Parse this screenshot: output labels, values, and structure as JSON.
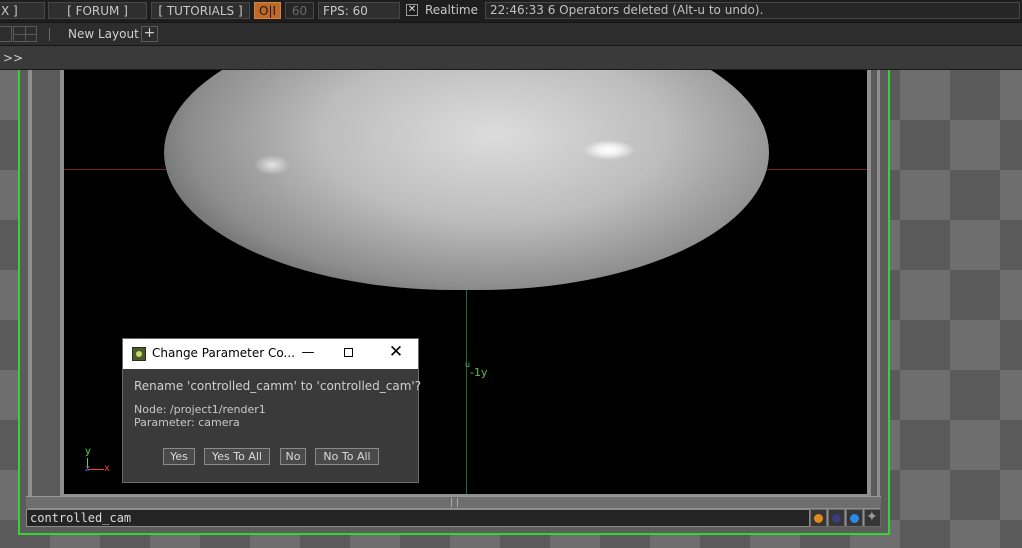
{
  "topbar": {
    "cut_label": "X ]",
    "forum_label": "[ FORUM ]",
    "tutorials_label": "[ TUTORIALS ]",
    "oi_label": "O|I",
    "fps_target": "60",
    "fps_label": "FPS:  60",
    "realtime_checked": "✕",
    "realtime_label": "Realtime",
    "status_message": "22:46:33 6 Operators deleted (Alt-u to undo)."
  },
  "layoutbar": {
    "new_layout_label": "New Layout",
    "add_label": "+"
  },
  "pathbar": {
    "chevron": ">>"
  },
  "viewer": {
    "y_axis_label": "-1y",
    "y_axis_tick": "u",
    "gizmo_y": "y",
    "gizmo_z": "z",
    "gizmo_x": "x"
  },
  "name_field": {
    "value": "controlled_cam"
  },
  "flags": [
    {
      "icon": "orange-dot-icon",
      "color": "#e08a1e"
    },
    {
      "icon": "dark-blue-dot-icon",
      "color": "#3a3d7a"
    },
    {
      "icon": "blue-dot-icon",
      "color": "#2a8ae8"
    },
    {
      "icon": "star-icon",
      "color": "#9a9a9a"
    }
  ],
  "dialog": {
    "title": "Change Parameter Co...",
    "minimize": "—",
    "close": "✕",
    "message": "Rename 'controlled_camm' to 'controlled_cam'?",
    "node": "Node: /project1/render1",
    "parameter": "Parameter: camera",
    "buttons": {
      "yes": "Yes",
      "yes_to_all": "Yes To All",
      "no": "No",
      "no_to_all": "No To All"
    }
  },
  "colors": {
    "selection_border": "#33d433",
    "oi_accent": "#c06a2a"
  }
}
